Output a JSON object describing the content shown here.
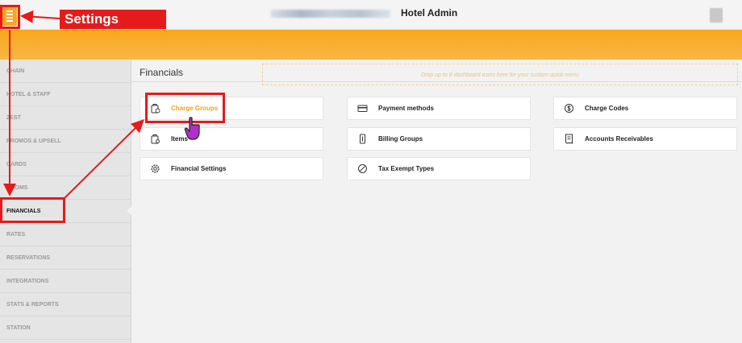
{
  "header": {
    "title": "Hotel Admin",
    "quick_menu_hint": "Drop up to 8 dashboard icons here for your custom quick menu"
  },
  "annotation": {
    "label": "Settings"
  },
  "sidebar": {
    "items": [
      {
        "label": "CHAIN"
      },
      {
        "label": "HOTEL & STAFF"
      },
      {
        "label": "ZEST"
      },
      {
        "label": "PROMOS & UPSELL"
      },
      {
        "label": "CARDS"
      },
      {
        "label": "ROOMS"
      },
      {
        "label": "FINANCIALS"
      },
      {
        "label": "RATES"
      },
      {
        "label": "RESERVATIONS"
      },
      {
        "label": "INTEGRATIONS"
      },
      {
        "label": "STATS & REPORTS"
      },
      {
        "label": "STATION"
      }
    ],
    "active": "FINANCIALS"
  },
  "main": {
    "title": "Financials",
    "cards": [
      {
        "label": "Charge Groups",
        "icon": "charge-group-icon"
      },
      {
        "label": "Payment methods",
        "icon": "credit-card-icon"
      },
      {
        "label": "Charge Codes",
        "icon": "dollar-circle-icon"
      },
      {
        "label": "Items",
        "icon": "bag-icon"
      },
      {
        "label": "Billing Groups",
        "icon": "billing-icon"
      },
      {
        "label": "Accounts Receivables",
        "icon": "receipt-icon"
      },
      {
        "label": "Financial Settings",
        "icon": "gear-icon"
      },
      {
        "label": "Tax Exempt Types",
        "icon": "tax-exempt-icon"
      }
    ]
  },
  "colors": {
    "accent": "#f6a823",
    "annotation": "#e51b1b",
    "highlight_text": "#f0a21c"
  }
}
